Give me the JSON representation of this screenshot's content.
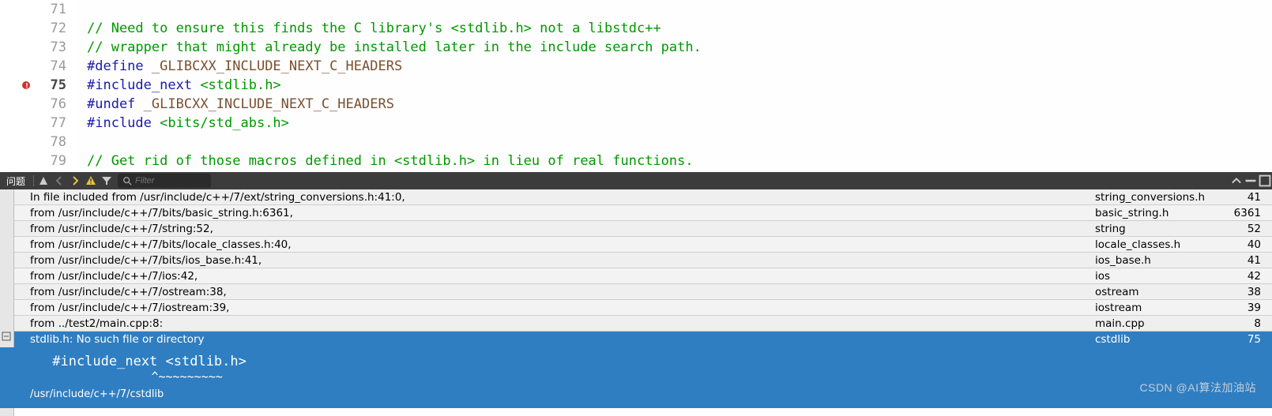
{
  "editor": {
    "lines": [
      {
        "num": 71,
        "segs": []
      },
      {
        "num": 72,
        "segs": [
          {
            "cls": "tok-comment",
            "t": "// Need to ensure this finds the C library's <stdlib.h> not a libstdc++"
          }
        ]
      },
      {
        "num": 73,
        "segs": [
          {
            "cls": "tok-comment",
            "t": "// wrapper that might already be installed later in the include search path."
          }
        ]
      },
      {
        "num": 74,
        "segs": [
          {
            "cls": "tok-macro",
            "t": "#define"
          },
          {
            "cls": "",
            "t": " "
          },
          {
            "cls": "tok-ident",
            "t": "_GLIBCXX_INCLUDE_NEXT_C_HEADERS"
          }
        ]
      },
      {
        "num": 75,
        "err": true,
        "active": true,
        "segs": [
          {
            "cls": "tok-macro",
            "t": "#include_next"
          },
          {
            "cls": "",
            "t": " "
          },
          {
            "cls": "tok-inc",
            "t": "<stdlib.h>"
          }
        ]
      },
      {
        "num": 76,
        "segs": [
          {
            "cls": "tok-macro",
            "t": "#undef"
          },
          {
            "cls": "",
            "t": " "
          },
          {
            "cls": "tok-ident",
            "t": "_GLIBCXX_INCLUDE_NEXT_C_HEADERS"
          }
        ]
      },
      {
        "num": 77,
        "segs": [
          {
            "cls": "tok-macro",
            "t": "#include"
          },
          {
            "cls": "",
            "t": " "
          },
          {
            "cls": "tok-inc",
            "t": "<bits/std_abs.h>"
          }
        ]
      },
      {
        "num": 78,
        "segs": []
      },
      {
        "num": 79,
        "segs": [
          {
            "cls": "tok-comment",
            "t": "// Get rid of those macros defined in <stdlib.h> in lieu of real functions."
          }
        ]
      }
    ]
  },
  "panel": {
    "tab_label": "问题",
    "filter_placeholder": "Filter",
    "rows": [
      {
        "msg": "In file included from /usr/include/c++/7/ext/string_conversions.h:41:0,",
        "file": "string_conversions.h",
        "line": 41
      },
      {
        "msg": "from /usr/include/c++/7/bits/basic_string.h:6361,",
        "file": "basic_string.h",
        "line": 6361
      },
      {
        "msg": "from /usr/include/c++/7/string:52,",
        "file": "string",
        "line": 52
      },
      {
        "msg": "from /usr/include/c++/7/bits/locale_classes.h:40,",
        "file": "locale_classes.h",
        "line": 40
      },
      {
        "msg": "from /usr/include/c++/7/bits/ios_base.h:41,",
        "file": "ios_base.h",
        "line": 41
      },
      {
        "msg": "from /usr/include/c++/7/ios:42,",
        "file": "ios",
        "line": 42
      },
      {
        "msg": "from /usr/include/c++/7/ostream:38,",
        "file": "ostream",
        "line": 38
      },
      {
        "msg": "from /usr/include/c++/7/iostream:39,",
        "file": "iostream",
        "line": 39
      },
      {
        "msg": "from ../test2/main.cpp:8:",
        "file": "main.cpp",
        "line": 8
      }
    ],
    "selected": {
      "msg": "stdlib.h: No such file or directory",
      "file": "cstdlib",
      "line": 75,
      "snippet": " #include_next <stdlib.h>",
      "caret": "               ^~~~~~~~~~",
      "path": "/usr/include/c++/7/cstdlib"
    }
  },
  "watermark": "CSDN @AI算法加油站"
}
